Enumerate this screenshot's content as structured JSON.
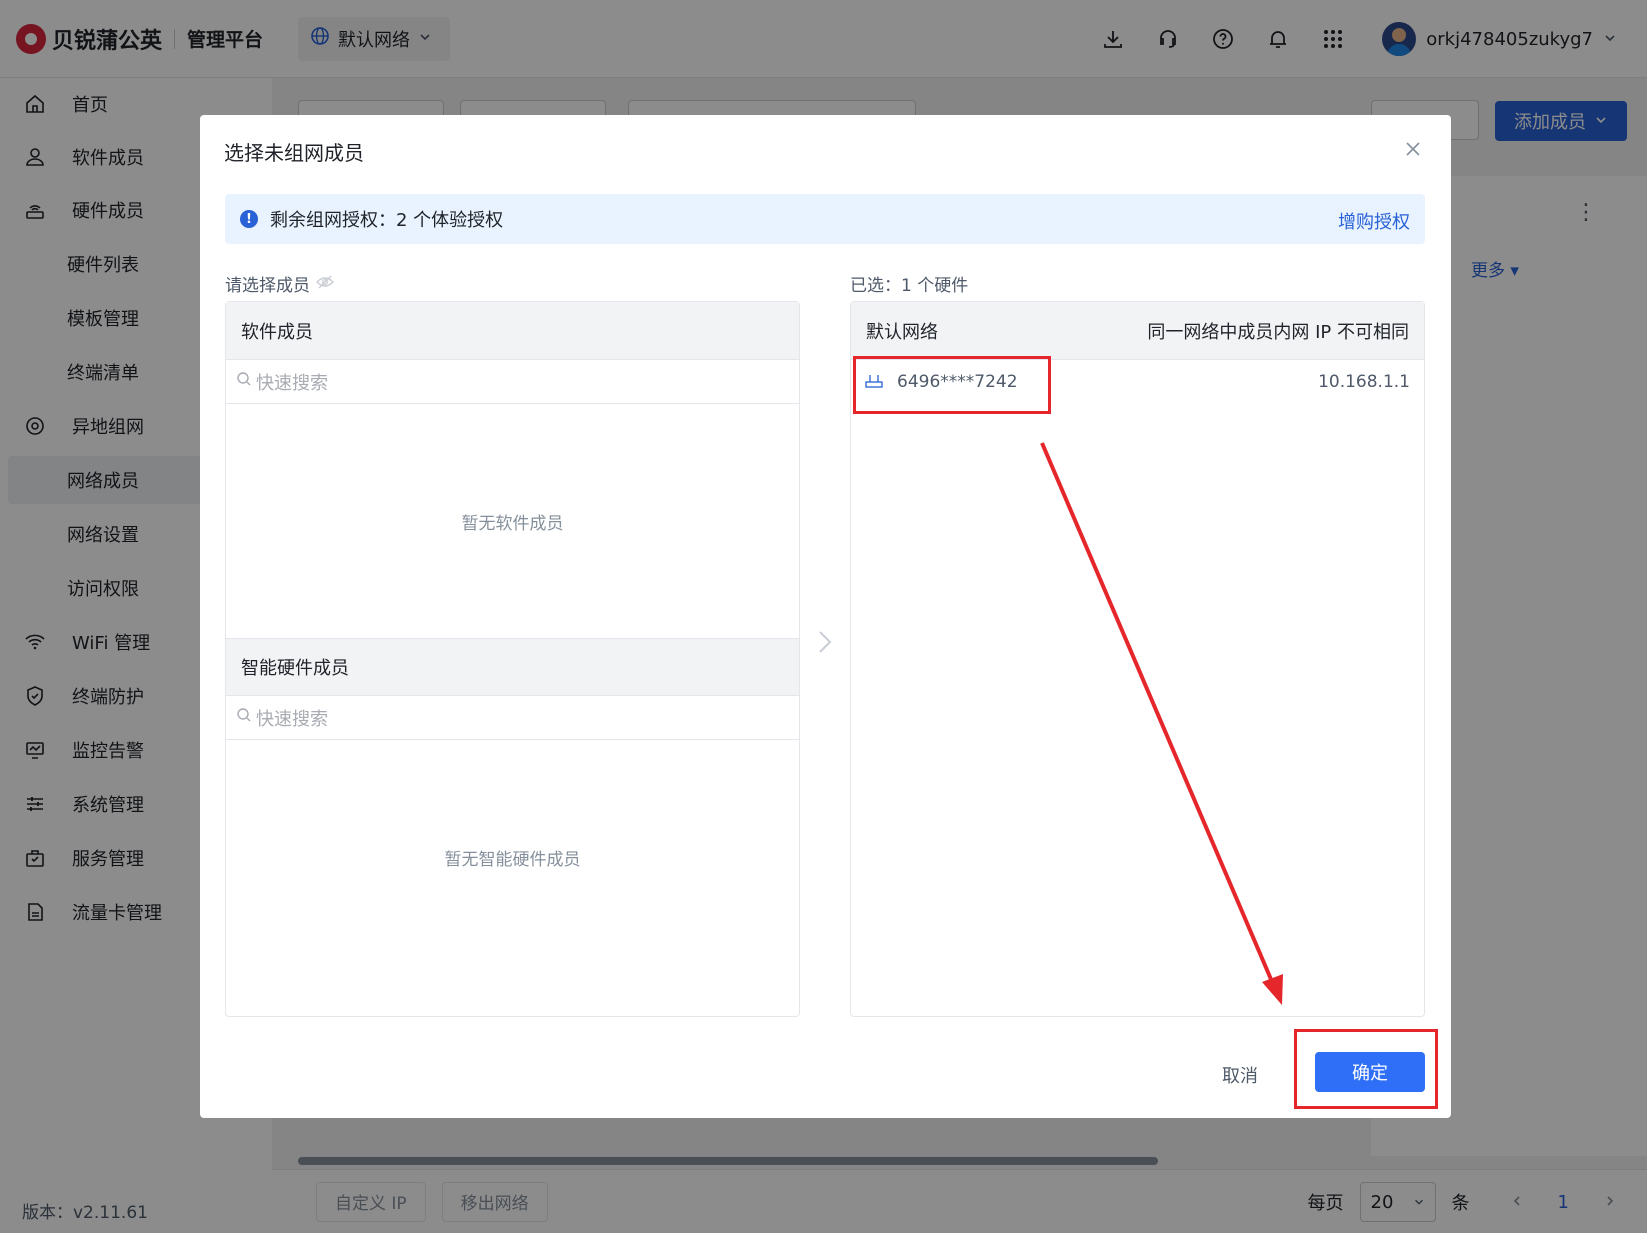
{
  "header": {
    "brand_name": "贝锐蒲公英",
    "brand_sub": "管理平台",
    "network": "默认网络",
    "username": "orkj478405zukyg7"
  },
  "sidebar": {
    "items": [
      {
        "label": "首页",
        "icon": "home-icon"
      },
      {
        "label": "软件成员",
        "icon": "user-icon"
      },
      {
        "label": "硬件成员",
        "icon": "router-icon"
      },
      {
        "label": "硬件列表"
      },
      {
        "label": "模板管理"
      },
      {
        "label": "终端清单"
      },
      {
        "label": "异地组网",
        "icon": "network-icon"
      },
      {
        "label": "网络成员"
      },
      {
        "label": "网络设置"
      },
      {
        "label": "访问权限"
      },
      {
        "label": "WiFi 管理",
        "icon": "wifi-icon"
      },
      {
        "label": "终端防护",
        "icon": "shield-icon"
      },
      {
        "label": "监控告警",
        "icon": "monitor-icon"
      },
      {
        "label": "系统管理",
        "icon": "sliders-icon"
      },
      {
        "label": "服务管理",
        "icon": "briefcase-icon"
      },
      {
        "label": "流量卡管理",
        "icon": "simcard-icon"
      }
    ],
    "version": "版本：v2.11.61"
  },
  "main": {
    "add_member": "添加成员",
    "more": "更多",
    "bottom_buttons": [
      "自定义 IP",
      "移出网络"
    ],
    "pager": {
      "per_page_label": "每页",
      "per_page": "20",
      "unit": "条",
      "page": "1"
    }
  },
  "modal": {
    "title": "选择未组网成员",
    "notice": "剩余组网授权：2 个体验授权",
    "notice_link": "增购授权",
    "left_label": "请选择成员",
    "software_title": "软件成员",
    "search_placeholder": "快速搜索",
    "software_empty": "暂无软件成员",
    "hardware_title": "智能硬件成员",
    "hardware_empty": "暂无智能硬件成员",
    "selected_label": "已选：1 个硬件",
    "right_title": "默认网络",
    "right_hint": "同一网络中成员内网 IP 不可相同",
    "selected": [
      {
        "device": "6496****7242",
        "ip": "10.168.1.1"
      }
    ],
    "cancel": "取消",
    "confirm": "确定"
  },
  "colors": {
    "primary": "#2961d6",
    "annotation": "#e5262b"
  }
}
